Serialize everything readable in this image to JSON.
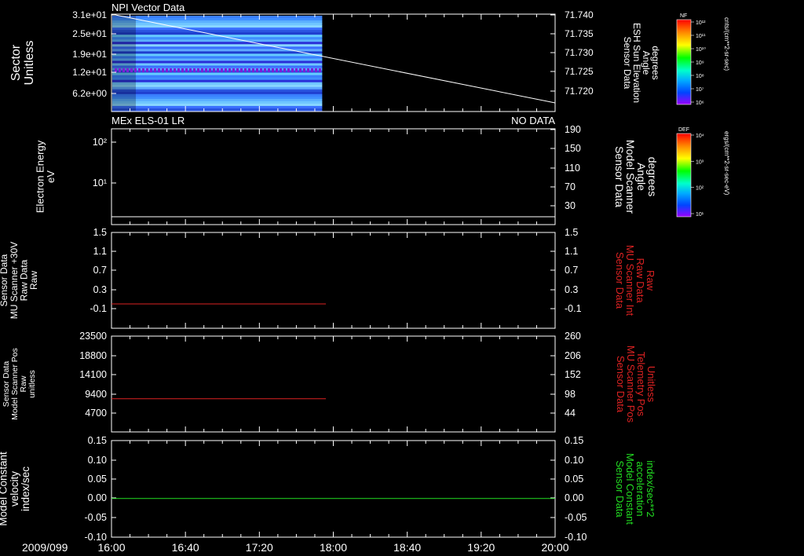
{
  "colors": {
    "background": "#000000",
    "axis": "#ffffff",
    "red_trace": "#dd2222",
    "green_trace": "#22dd22",
    "spectro_bands": [
      "#3a7fff",
      "#5fa9ff",
      "#2a2fd8",
      "#66ccff",
      "#3a6fff",
      "#5bb0ff",
      "#1f3fd0",
      "#88d6ff",
      "#3f8fff",
      "#2a55e0",
      "#6fc6ff"
    ]
  },
  "footer": {
    "date_label": "2009/099"
  },
  "time_ticks": [
    "16:00",
    "16:40",
    "17:20",
    "18:00",
    "18:40",
    "19:20",
    "20:00"
  ],
  "chart_data": [
    {
      "id": "panel1",
      "type": "heatmap",
      "title": "NPI Vector Data",
      "title_right": "",
      "ylabel_left": [
        "Sector",
        "Unitless"
      ],
      "ylabel_right": [
        "Sensor Data",
        "ESH Sun Elevation",
        "Angle",
        "degrees"
      ],
      "left_ticks": [
        "3.1e+01",
        "2.5e+01",
        "1.9e+01",
        "1.2e+01",
        "6.2e+00"
      ],
      "right_ticks": [
        "71.740",
        "71.735",
        "71.730",
        "71.725",
        "71.720"
      ],
      "ylim_right": [
        71.7175,
        71.74
      ],
      "data_until": "17:54",
      "line_right_axis": {
        "x": [
          "16:00",
          "20:00"
        ],
        "y": [
          71.74,
          71.7195
        ]
      },
      "colorbar": {
        "label": "NF",
        "units": "cnts/(cm**2-sr-sec)",
        "ticks": [
          "10¹²",
          "10¹¹",
          "10¹⁰",
          "10⁹",
          "10⁸",
          "10⁷",
          "10⁶"
        ]
      }
    },
    {
      "id": "panel2",
      "type": "line",
      "title": "MEx ELS-01 LR",
      "title_right": "NO DATA",
      "ylabel_left": [
        "Electron Energy",
        "eV"
      ],
      "ylabel_right": [
        "Sensor Data",
        "Model Scanner",
        "Angle",
        "degrees"
      ],
      "left_ticks": [
        "10²",
        "10¹"
      ],
      "right_ticks": [
        "190",
        "150",
        "110",
        "70",
        "30"
      ],
      "ylim_right": [
        0,
        190
      ],
      "line_right_axis": {
        "x": [
          "16:00",
          "20:00"
        ],
        "y": [
          7,
          7
        ]
      },
      "colorbar": {
        "label": "DEF",
        "units": "ergs/(cm**2-sr-sec-eV)",
        "ticks": [
          "10⁴",
          "10³",
          "10²",
          "10¹"
        ]
      }
    },
    {
      "id": "panel3",
      "type": "line",
      "ylabel_left": [
        "Sensor Data",
        "MU Scanner +30V",
        "Raw Data",
        "Raw"
      ],
      "ylabel_right": [
        "Sensor Data",
        "MU Scanner Int",
        "Raw Data",
        "Raw"
      ],
      "left_ticks": [
        "1.5",
        "1.1",
        "0.7",
        "0.3",
        "-0.1"
      ],
      "right_ticks": [
        "1.5",
        "1.1",
        "0.7",
        "0.3",
        "-0.1"
      ],
      "ylim": [
        -0.33,
        1.5
      ],
      "series": [
        {
          "x": [
            "16:00",
            "17:56"
          ],
          "y": [
            0.0,
            0.0
          ]
        }
      ]
    },
    {
      "id": "panel4",
      "type": "line",
      "ylabel_left": [
        "Sensor Data",
        "Model Scanner Pos",
        "Raw",
        "unitless"
      ],
      "ylabel_right": [
        "Sensor Data",
        "MU Scanner Pos",
        "Telemetry Pos",
        "Unitless"
      ],
      "left_ticks": [
        "23500",
        "18800",
        "14100",
        "9400",
        "4700"
      ],
      "right_ticks": [
        "260",
        "206",
        "152",
        "98",
        "44"
      ],
      "ylim": [
        0,
        23500
      ],
      "series": [
        {
          "x": [
            "16:00",
            "17:56"
          ],
          "y": [
            8200,
            8200
          ]
        }
      ]
    },
    {
      "id": "panel5",
      "type": "line",
      "ylabel_left": [
        "Sensor Data",
        "Model Constant",
        "velocity",
        "index/sec"
      ],
      "ylabel_right": [
        "Sensor Data",
        "Model Constant",
        "acceleration",
        "index/sec**2"
      ],
      "left_ticks": [
        "0.15",
        "0.10",
        "0.05",
        "0.00",
        "-0.05",
        "-0.10"
      ],
      "right_ticks": [
        "0.15",
        "0.10",
        "0.05",
        "0.00",
        "-0.05",
        "-0.10"
      ],
      "ylim": [
        -0.1,
        0.15
      ],
      "series": [
        {
          "x": [
            "16:00",
            "20:00"
          ],
          "y": [
            0.0,
            0.0
          ]
        }
      ]
    }
  ]
}
